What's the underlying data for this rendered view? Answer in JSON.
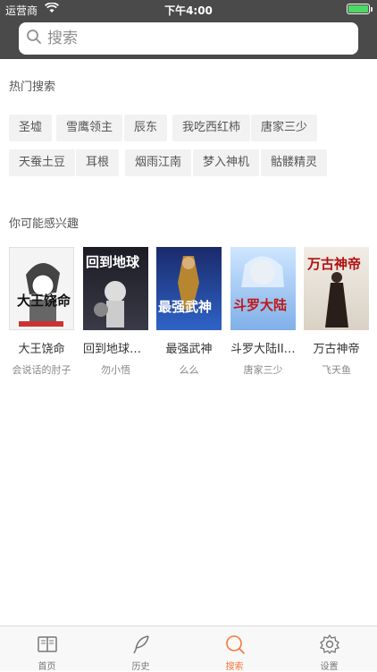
{
  "status_bar": {
    "carrier": "运营商",
    "time": "下午4:00",
    "battery_level": 1.0
  },
  "search": {
    "placeholder": "搜索"
  },
  "hot_search": {
    "title": "热门搜索",
    "tags": [
      "圣墟",
      "雪鹰领主",
      "辰东",
      "我吃西红柿",
      "唐家三少",
      "天蚕土豆",
      "耳根",
      "烟雨江南",
      "梦入神机",
      "骷髅精灵"
    ]
  },
  "recommend": {
    "title": "你可能感兴趣",
    "books": [
      {
        "title": "大王饶命",
        "author": "会说话的肘子",
        "cover_text": "大王饶命"
      },
      {
        "title": "回到地球当神棍",
        "author": "勿小悟",
        "cover_text": "回到地球"
      },
      {
        "title": "最强武神",
        "author": "么么",
        "cover_text": "最强武神"
      },
      {
        "title": "斗罗大陆III龙王传说",
        "author": "唐家三少",
        "cover_text": "斗罗大陆"
      },
      {
        "title": "万古神帝",
        "author": "飞天鱼",
        "cover_text": "万古神帝"
      }
    ]
  },
  "tab_bar": {
    "tabs": [
      {
        "label": "首页",
        "icon": "book-icon"
      },
      {
        "label": "历史",
        "icon": "feather-icon"
      },
      {
        "label": "搜索",
        "icon": "search-icon",
        "active": true
      },
      {
        "label": "设置",
        "icon": "gear-icon"
      }
    ],
    "accent": "#f5793a"
  }
}
